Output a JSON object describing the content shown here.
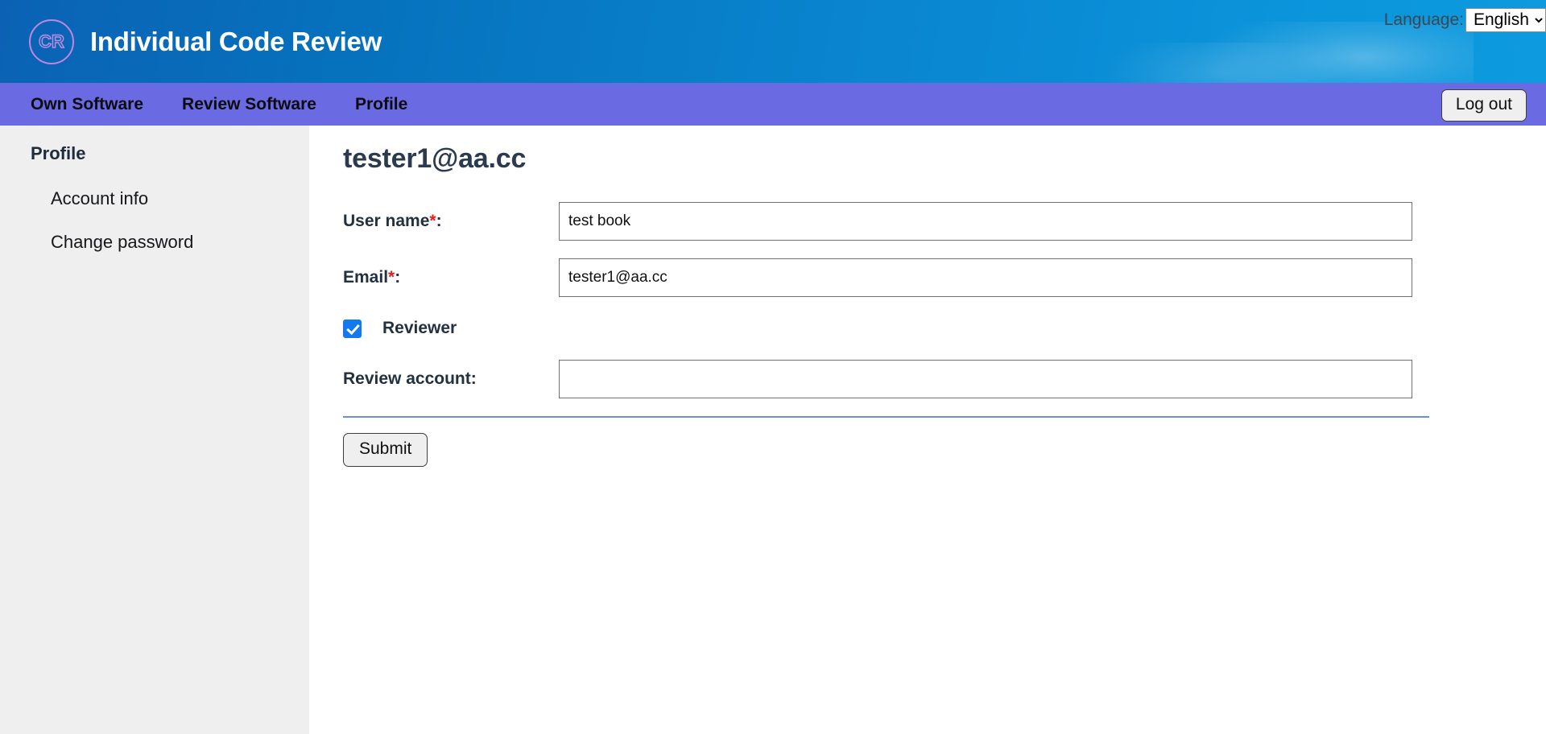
{
  "header": {
    "logo_text": "CR",
    "logo_icon": "circle-monogram-icon",
    "title": "Individual Code Review",
    "language_label": "Language:",
    "language_value": "English",
    "language_options": [
      "English"
    ]
  },
  "nav": {
    "items": [
      {
        "label": "Own Software"
      },
      {
        "label": "Review Software"
      },
      {
        "label": "Profile"
      }
    ],
    "logout_label": "Log out"
  },
  "sidebar": {
    "title": "Profile",
    "items": [
      {
        "label": "Account info"
      },
      {
        "label": "Change password"
      }
    ]
  },
  "main": {
    "title": "tester1@aa.cc",
    "fields": [
      {
        "label": "User name",
        "required_mark": "*",
        "colon": ":",
        "value": "test book",
        "placeholder": ""
      },
      {
        "label": "Email",
        "required_mark": "*",
        "colon": ":",
        "value": "tester1@aa.cc",
        "placeholder": ""
      }
    ],
    "checkbox": {
      "label": "Reviewer",
      "checked": true
    },
    "review_account": {
      "label": "Review account:",
      "value": "",
      "placeholder": ""
    },
    "submit_label": "Submit"
  },
  "colors": {
    "header_start": "#0b62b4",
    "header_end": "#0e9ade",
    "nav_bg": "#6a6ae3",
    "sidebar_bg": "#efefef",
    "accent_checkbox": "#1279ee",
    "divider": "#6c8ce0",
    "required_asterisk": "#e02020",
    "logo_stroke": "#bf86e0"
  }
}
